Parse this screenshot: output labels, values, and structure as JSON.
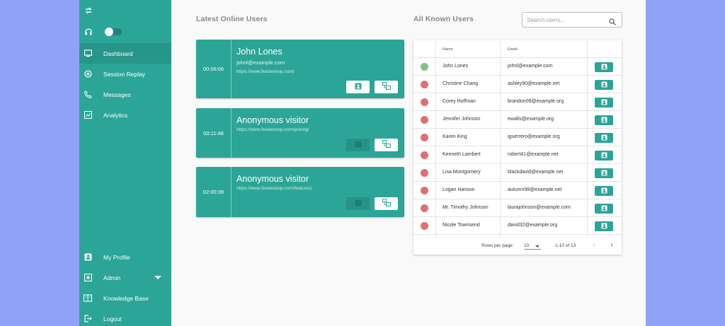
{
  "sidebar": {
    "nav": [
      {
        "label": "Dashboard",
        "icon": "monitor-icon",
        "active": true
      },
      {
        "label": "Session Replay",
        "icon": "replay-icon"
      },
      {
        "label": "Messages",
        "icon": "phone-icon"
      },
      {
        "label": "Analytics",
        "icon": "analytics-icon"
      }
    ],
    "bottom": [
      {
        "label": "My Profile",
        "icon": "profile-icon"
      },
      {
        "label": "Admin",
        "icon": "admin-icon"
      },
      {
        "label": "Knowledge Base",
        "icon": "book-icon"
      },
      {
        "label": "Logout",
        "icon": "logout-icon"
      }
    ]
  },
  "online": {
    "title": "Latest Online Users",
    "visitors": [
      {
        "time": "00:06:06",
        "name": "John Lones",
        "email": "johnl@example.com",
        "url": "https://www.feederloop.com/"
      },
      {
        "time": "00:11:48",
        "name": "Anonymous visitor",
        "email": "",
        "url": "https://www.feederloop.com/pricing/"
      },
      {
        "time": "02:00:39",
        "name": "Anonymous visitor",
        "email": "",
        "url": "https://www.feederloop.com/features/"
      }
    ]
  },
  "known": {
    "title": "All Known Users",
    "search_placeholder": "Search users...",
    "columns": {
      "name": "Name",
      "email": "Email"
    },
    "rows": [
      {
        "name": "John Lones",
        "email": "johnl@example.com",
        "online": true
      },
      {
        "name": "Christine Chang",
        "email": "ashley90@example.net",
        "online": false
      },
      {
        "name": "Corey Hoffman",
        "email": "brandon08@example.org",
        "online": false
      },
      {
        "name": "Jennifer Johnson",
        "email": "ewalls@example.org",
        "online": false
      },
      {
        "name": "Karen King",
        "email": "iguerrero@example.org",
        "online": false
      },
      {
        "name": "Kenneth Lambert",
        "email": "robert41@example.net",
        "online": false
      },
      {
        "name": "Lisa Montgomery",
        "email": "blackdavid@example.net",
        "online": false
      },
      {
        "name": "Logan Hanson",
        "email": "autumn98@example.net",
        "online": false
      },
      {
        "name": "Mr. Timothy Johnson",
        "email": "laurajohnson@example.com",
        "online": false
      },
      {
        "name": "Nicole Townsend",
        "email": "david32@example.org",
        "online": false
      }
    ],
    "pager": {
      "rows_label": "Rows per page:",
      "rows_value": "10",
      "range": "1-10 of 13"
    }
  },
  "colors": {
    "teal": "#2ba597",
    "online": "#7cc47f",
    "offline": "#e07070",
    "page_bg": "#8fa2f5"
  }
}
